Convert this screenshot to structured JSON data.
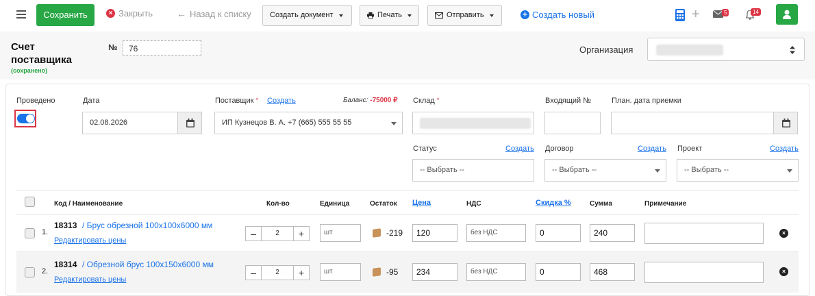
{
  "toolbar": {
    "save_label": "Сохранить",
    "close_label": "Закрыть",
    "back_label": "Назад к списку",
    "create_doc_label": "Создать документ",
    "print_label": "Печать",
    "send_label": "Отправить",
    "create_new_label": "Создать новый",
    "mail_badge": "5",
    "notify_badge": "14"
  },
  "header": {
    "title_line1": "Счет",
    "title_line2": "поставщика",
    "saved_text": "(сохранено)",
    "number_label": "№",
    "number_value": "76",
    "org_label": "Организация"
  },
  "form": {
    "posted_label": "Проведено",
    "posted": true,
    "date_label": "Дата",
    "date_value": "02.08.2026",
    "supplier_label": "Поставщик",
    "supplier_create": "Создать",
    "balance_label": "Баланс:",
    "balance_value": "-75000 ₽",
    "supplier_value": "ИП Кузнецов В. А. +7 (665) 555 55 55",
    "warehouse_label": "Склад",
    "incoming_label": "Входящий №",
    "plan_date_label": "План. дата приемки",
    "status_label": "Статус",
    "status_create": "Создать",
    "status_value": "-- Выбрать --",
    "contract_label": "Договор",
    "contract_create": "Создать",
    "contract_value": "-- Выбрать --",
    "project_label": "Проект",
    "project_create": "Создать",
    "project_value": "-- Выбрать --"
  },
  "table": {
    "columns": {
      "name": "Код / Наименование",
      "qty": "Кол-во",
      "unit": "Единица",
      "stock": "Остаток",
      "price": "Цена",
      "vat": "НДС",
      "discount": "Скидка %",
      "sum": "Сумма",
      "note": "Примечание"
    },
    "rows": [
      {
        "idx": "1.",
        "code": "18313",
        "name": "/ Брус обрезной 100х100х6000 мм",
        "edit": "Редактировать цены",
        "qty": "2",
        "unit": "шт",
        "stock": "-219",
        "price": "120",
        "vat": "без НДС",
        "discount": "0",
        "sum": "240",
        "note": ""
      },
      {
        "idx": "2.",
        "code": "18314",
        "name": "/ Обрезной брус 100х150х6000 мм",
        "edit": "Редактировать цены",
        "qty": "2",
        "unit": "шт",
        "stock": "-95",
        "price": "234",
        "vat": "без НДС",
        "discount": "0",
        "sum": "468",
        "note": ""
      }
    ],
    "stepper_minus": "–",
    "stepper_plus": "+"
  },
  "colors": {
    "accent": "#1a73e8",
    "success": "#28a745",
    "danger": "#dc3545"
  }
}
